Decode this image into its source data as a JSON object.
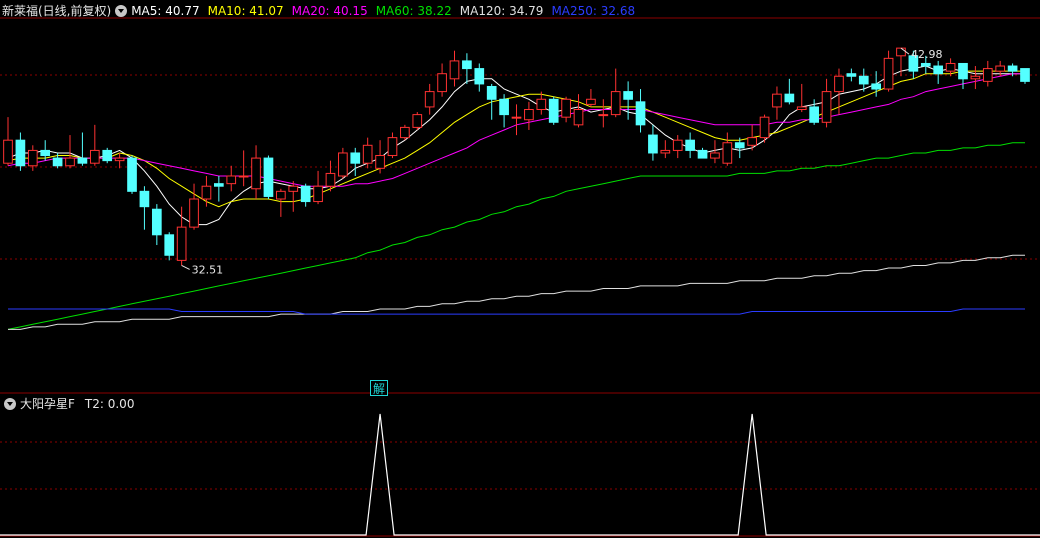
{
  "top_legend": {
    "stock": "新莱福(日线,前复权)",
    "items": [
      {
        "label": "MA5: 40.77",
        "color": "#ffffff"
      },
      {
        "label": "MA10: 41.07",
        "color": "#ffff00"
      },
      {
        "label": "MA20: 40.15",
        "color": "#ff00ff"
      },
      {
        "label": "MA60: 38.22",
        "color": "#00e000"
      },
      {
        "label": "MA120: 34.79",
        "color": "#e0e0e0"
      },
      {
        "label": "MA250: 32.68",
        "color": "#2b3cff"
      }
    ]
  },
  "bottom_legend": {
    "indicator": "大阳孕星F",
    "t2": "T2: 0.00"
  },
  "marker": "解",
  "price_marks": {
    "high": "42.98",
    "low": "32.51"
  },
  "colors": {
    "up": "#ff3232",
    "down": "#54ffff",
    "grid": "#8b0000",
    "background": "#000000"
  },
  "chart_data": {
    "type": "candlestick",
    "ma_levels": {
      "MA5": 40.77,
      "MA10": 41.07,
      "MA20": 40.15,
      "MA60": 38.22,
      "MA120": 34.79,
      "MA250": 32.68
    },
    "high_mark": 42.98,
    "low_mark": 32.51,
    "candles": [
      [
        38.4,
        39.3,
        38.3,
        40.2
      ],
      [
        39.3,
        38.3,
        38.1,
        39.6
      ],
      [
        38.3,
        38.9,
        38.1,
        39.1
      ],
      [
        38.9,
        38.7,
        38.5,
        39.3
      ],
      [
        38.6,
        38.3,
        38.2,
        38.8
      ],
      [
        38.3,
        38.6,
        38.2,
        39.5
      ],
      [
        38.6,
        38.4,
        38.3,
        39.6
      ],
      [
        38.4,
        38.9,
        38.3,
        39.9
      ],
      [
        38.9,
        38.5,
        38.4,
        39.0
      ],
      [
        38.5,
        38.6,
        38.2,
        38.8
      ],
      [
        38.6,
        37.3,
        37.2,
        38.7
      ],
      [
        37.3,
        36.7,
        35.8,
        37.5
      ],
      [
        36.6,
        35.6,
        35.2,
        36.8
      ],
      [
        35.6,
        34.8,
        34.6,
        35.7
      ],
      [
        34.6,
        35.9,
        34.4,
        36.7
      ],
      [
        35.9,
        37.0,
        35.8,
        37.6
      ],
      [
        37.0,
        37.5,
        36.7,
        37.9
      ],
      [
        37.6,
        37.5,
        36.9,
        37.9
      ],
      [
        37.6,
        37.9,
        37.3,
        38.3
      ],
      [
        37.9,
        37.9,
        37.5,
        38.9
      ],
      [
        37.4,
        38.6,
        37.0,
        39.1
      ],
      [
        38.6,
        37.1,
        37.0,
        38.7
      ],
      [
        37.0,
        37.3,
        36.3,
        37.4
      ],
      [
        37.3,
        37.5,
        36.5,
        37.7
      ],
      [
        37.5,
        36.9,
        36.7,
        37.6
      ],
      [
        36.9,
        37.5,
        36.8,
        38.1
      ],
      [
        37.5,
        38.0,
        37.3,
        38.5
      ],
      [
        37.9,
        38.8,
        37.8,
        39.0
      ],
      [
        38.8,
        38.4,
        37.9,
        39.0
      ],
      [
        38.4,
        39.1,
        38.2,
        39.4
      ],
      [
        38.2,
        38.7,
        38.0,
        39.3
      ],
      [
        38.7,
        39.4,
        38.6,
        39.6
      ],
      [
        39.4,
        39.8,
        39.3,
        39.9
      ],
      [
        39.8,
        40.3,
        39.7,
        40.4
      ],
      [
        40.6,
        41.2,
        40.3,
        41.5
      ],
      [
        41.2,
        41.9,
        41.0,
        42.3
      ],
      [
        41.7,
        42.4,
        41.4,
        42.8
      ],
      [
        42.4,
        42.1,
        41.5,
        42.7
      ],
      [
        42.1,
        41.5,
        41.2,
        42.3
      ],
      [
        41.4,
        40.9,
        40.1,
        41.5
      ],
      [
        40.9,
        40.3,
        39.8,
        41.1
      ],
      [
        40.2,
        40.2,
        39.5,
        40.7
      ],
      [
        40.1,
        40.5,
        39.7,
        40.8
      ],
      [
        40.5,
        40.9,
        40.3,
        41.2
      ],
      [
        40.9,
        40.0,
        39.9,
        41.0
      ],
      [
        40.2,
        40.9,
        40.0,
        41.0
      ],
      [
        39.9,
        40.5,
        39.8,
        41.1
      ],
      [
        40.7,
        40.9,
        40.6,
        41.3
      ],
      [
        40.3,
        40.3,
        39.8,
        40.9
      ],
      [
        40.3,
        41.2,
        40.2,
        42.1
      ],
      [
        41.2,
        40.9,
        40.1,
        41.6
      ],
      [
        40.8,
        39.9,
        39.6,
        41.3
      ],
      [
        39.5,
        38.8,
        38.5,
        39.9
      ],
      [
        38.8,
        38.9,
        38.6,
        39.3
      ],
      [
        38.9,
        39.3,
        38.6,
        39.5
      ],
      [
        39.3,
        38.9,
        38.6,
        39.6
      ],
      [
        38.9,
        38.6,
        38.6,
        39.0
      ],
      [
        38.6,
        38.8,
        38.4,
        39.3
      ],
      [
        38.4,
        39.2,
        38.3,
        39.6
      ],
      [
        39.2,
        39.0,
        38.6,
        39.4
      ],
      [
        39.1,
        39.4,
        38.9,
        39.9
      ],
      [
        39.4,
        40.2,
        39.2,
        40.3
      ],
      [
        40.6,
        41.1,
        40.1,
        41.4
      ],
      [
        41.1,
        40.8,
        40.7,
        41.7
      ],
      [
        40.5,
        40.6,
        40.4,
        41.5
      ],
      [
        40.6,
        40.0,
        39.9,
        40.9
      ],
      [
        40.0,
        41.2,
        39.8,
        41.7
      ],
      [
        41.2,
        41.8,
        40.3,
        42.1
      ],
      [
        41.9,
        41.8,
        41.6,
        42.1
      ],
      [
        41.8,
        41.5,
        41.2,
        42.1
      ],
      [
        41.5,
        41.3,
        41.0,
        42.0
      ],
      [
        41.3,
        42.5,
        41.2,
        42.8
      ],
      [
        42.6,
        42.9,
        41.8,
        42.9
      ],
      [
        42.6,
        42.0,
        41.7,
        42.8
      ],
      [
        42.3,
        42.2,
        41.9,
        42.6
      ],
      [
        42.2,
        41.9,
        41.5,
        42.4
      ],
      [
        42.0,
        42.3,
        41.8,
        42.5
      ],
      [
        42.3,
        41.7,
        41.3,
        42.3
      ],
      [
        41.7,
        41.8,
        41.3,
        42.2
      ],
      [
        41.6,
        42.1,
        41.4,
        42.4
      ],
      [
        42.0,
        42.2,
        41.8,
        42.4
      ],
      [
        42.2,
        42.0,
        41.8,
        42.3
      ],
      [
        42.1,
        41.6,
        41.5,
        42.1
      ]
    ],
    "ma_series": {
      "MA5": [
        38.6,
        38.8,
        38.8,
        38.9,
        38.8,
        38.8,
        38.6,
        38.6,
        38.7,
        38.9,
        38.6,
        38.1,
        37.5,
        36.8,
        36.3,
        36.0,
        36.0,
        36.2,
        36.9,
        37.3,
        37.6,
        37.7,
        37.6,
        37.5,
        37.4,
        37.4,
        37.5,
        37.8,
        38.2,
        38.4,
        38.6,
        39.0,
        39.3,
        39.7,
        40.1,
        40.6,
        41.2,
        41.6,
        41.7,
        41.7,
        41.3,
        41.1,
        40.9,
        40.6,
        40.4,
        40.5,
        40.6,
        40.4,
        40.5,
        40.6,
        40.4,
        40.3,
        39.9,
        39.5,
        39.2,
        39.0,
        38.8,
        38.9,
        39.0,
        38.9,
        39.0,
        39.3,
        39.7,
        40.3,
        40.6,
        40.7,
        40.8,
        41.1,
        41.2,
        41.3,
        41.5,
        41.8,
        42.0,
        42.1,
        42.2,
        42.0,
        42.1,
        42.0,
        41.9,
        41.9,
        41.9,
        41.9,
        41.9
      ],
      "MA10": [
        38.5,
        38.6,
        38.6,
        38.6,
        38.7,
        38.7,
        38.6,
        38.6,
        38.6,
        38.8,
        38.7,
        38.5,
        38.2,
        37.8,
        37.5,
        37.2,
        36.9,
        36.7,
        36.9,
        37.0,
        37.0,
        37.0,
        36.9,
        36.9,
        37.0,
        37.2,
        37.4,
        37.6,
        37.8,
        38.0,
        38.2,
        38.4,
        38.6,
        38.9,
        39.2,
        39.6,
        40.0,
        40.3,
        40.6,
        40.8,
        40.9,
        41.0,
        41.1,
        41.1,
        41.0,
        40.9,
        40.8,
        40.6,
        40.6,
        40.6,
        40.6,
        40.6,
        40.4,
        40.2,
        40.0,
        39.8,
        39.6,
        39.4,
        39.3,
        39.3,
        39.4,
        39.5,
        39.6,
        39.8,
        40.0,
        40.2,
        40.4,
        40.6,
        40.8,
        41.0,
        41.2,
        41.4,
        41.6,
        41.7,
        41.9,
        41.9,
        41.9,
        42.0,
        42.0,
        42.0,
        42.0,
        42.0,
        42.0
      ],
      "MA20": [
        38.3,
        38.4,
        38.4,
        38.5,
        38.6,
        38.6,
        38.6,
        38.6,
        38.6,
        38.6,
        38.6,
        38.5,
        38.4,
        38.3,
        38.2,
        38.1,
        38.0,
        37.9,
        37.9,
        37.9,
        37.9,
        37.8,
        37.7,
        37.6,
        37.5,
        37.5,
        37.5,
        37.5,
        37.6,
        37.6,
        37.7,
        37.8,
        38.0,
        38.2,
        38.4,
        38.6,
        38.8,
        39.0,
        39.3,
        39.5,
        39.7,
        39.9,
        40.0,
        40.1,
        40.2,
        40.3,
        40.4,
        40.5,
        40.5,
        40.5,
        40.5,
        40.5,
        40.4,
        40.3,
        40.2,
        40.1,
        40.0,
        39.9,
        39.9,
        39.9,
        39.9,
        39.9,
        40.0,
        40.0,
        40.1,
        40.1,
        40.2,
        40.3,
        40.4,
        40.5,
        40.6,
        40.7,
        40.9,
        41.0,
        41.2,
        41.3,
        41.4,
        41.5,
        41.6,
        41.7,
        41.8,
        41.9,
        41.9
      ],
      "MA60": [
        31.9,
        32.0,
        32.1,
        32.2,
        32.3,
        32.4,
        32.5,
        32.6,
        32.7,
        32.8,
        32.9,
        33.0,
        33.1,
        33.2,
        33.3,
        33.4,
        33.5,
        33.6,
        33.7,
        33.8,
        33.9,
        34.0,
        34.1,
        34.2,
        34.3,
        34.4,
        34.5,
        34.6,
        34.7,
        34.9,
        35.0,
        35.2,
        35.3,
        35.5,
        35.6,
        35.8,
        35.9,
        36.1,
        36.2,
        36.4,
        36.5,
        36.7,
        36.8,
        37.0,
        37.1,
        37.3,
        37.4,
        37.5,
        37.6,
        37.7,
        37.8,
        37.9,
        37.9,
        37.9,
        37.9,
        37.9,
        37.9,
        37.9,
        37.9,
        38.0,
        38.0,
        38.0,
        38.1,
        38.1,
        38.2,
        38.2,
        38.3,
        38.3,
        38.4,
        38.5,
        38.6,
        38.6,
        38.7,
        38.8,
        38.8,
        38.9,
        38.9,
        39.0,
        39.0,
        39.1,
        39.1,
        39.2,
        39.2
      ],
      "MA120": [
        31.9,
        31.9,
        32.0,
        32.0,
        32.1,
        32.1,
        32.1,
        32.2,
        32.2,
        32.2,
        32.3,
        32.3,
        32.3,
        32.3,
        32.4,
        32.4,
        32.4,
        32.4,
        32.4,
        32.4,
        32.4,
        32.4,
        32.5,
        32.5,
        32.5,
        32.5,
        32.5,
        32.6,
        32.6,
        32.6,
        32.7,
        32.7,
        32.7,
        32.8,
        32.8,
        32.9,
        32.9,
        33.0,
        33.0,
        33.1,
        33.1,
        33.2,
        33.2,
        33.3,
        33.3,
        33.4,
        33.4,
        33.4,
        33.5,
        33.5,
        33.5,
        33.6,
        33.6,
        33.6,
        33.6,
        33.7,
        33.7,
        33.7,
        33.7,
        33.8,
        33.8,
        33.8,
        33.9,
        33.9,
        33.9,
        34.0,
        34.0,
        34.1,
        34.1,
        34.2,
        34.2,
        34.3,
        34.3,
        34.4,
        34.4,
        34.5,
        34.5,
        34.6,
        34.6,
        34.7,
        34.7,
        34.8,
        34.8
      ],
      "MA250": [
        32.7,
        32.7,
        32.7,
        32.7,
        32.7,
        32.7,
        32.7,
        32.7,
        32.7,
        32.7,
        32.7,
        32.7,
        32.7,
        32.7,
        32.6,
        32.6,
        32.6,
        32.6,
        32.6,
        32.6,
        32.6,
        32.6,
        32.6,
        32.6,
        32.5,
        32.5,
        32.5,
        32.5,
        32.5,
        32.5,
        32.5,
        32.5,
        32.5,
        32.5,
        32.5,
        32.5,
        32.5,
        32.5,
        32.5,
        32.5,
        32.5,
        32.5,
        32.5,
        32.5,
        32.5,
        32.5,
        32.5,
        32.5,
        32.5,
        32.5,
        32.5,
        32.5,
        32.5,
        32.5,
        32.5,
        32.5,
        32.5,
        32.5,
        32.5,
        32.5,
        32.6,
        32.6,
        32.6,
        32.6,
        32.6,
        32.6,
        32.6,
        32.6,
        32.6,
        32.6,
        32.6,
        32.6,
        32.6,
        32.6,
        32.6,
        32.6,
        32.6,
        32.7,
        32.7,
        32.7,
        32.7,
        32.7,
        32.7
      ]
    },
    "indicator_spikes": [
      30,
      60
    ],
    "indicator_range": [
      0,
      1
    ]
  }
}
